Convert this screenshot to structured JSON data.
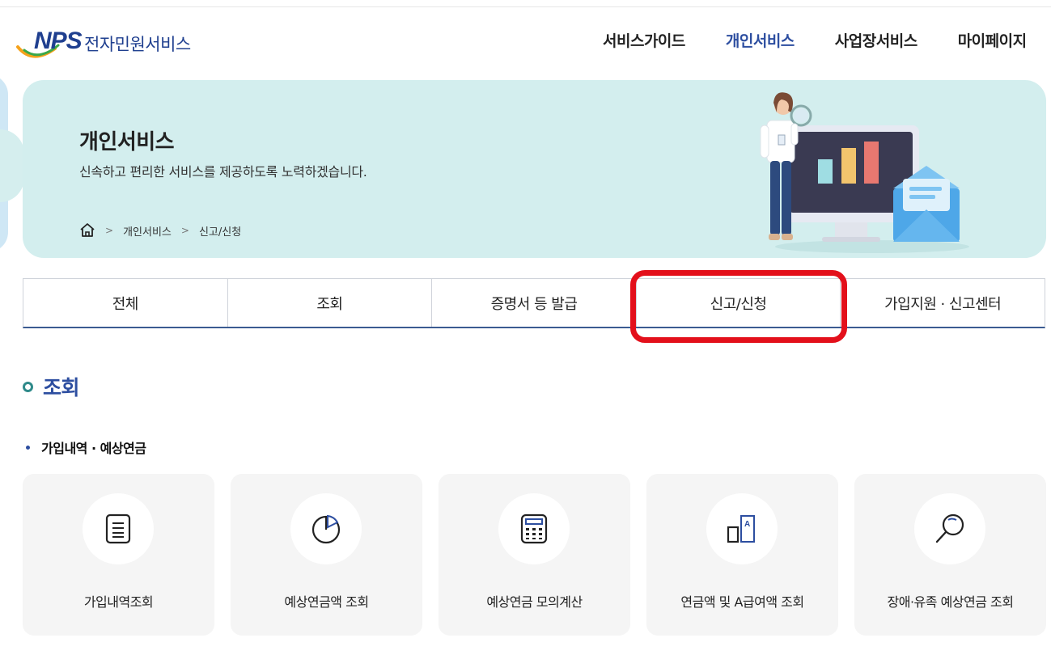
{
  "header": {
    "logo_mark": "NPS",
    "logo_text": "전자민원서비스",
    "nav": [
      {
        "label": "서비스가이드",
        "active": false
      },
      {
        "label": "개인서비스",
        "active": true
      },
      {
        "label": "사업장서비스",
        "active": false
      },
      {
        "label": "마이페이지",
        "active": false
      }
    ]
  },
  "banner": {
    "title": "개인서비스",
    "subtitle": "신속하고 편리한 서비스를 제공하도록 노력하겠습니다.",
    "breadcrumb": [
      "개인서비스",
      "신고/신청"
    ]
  },
  "tabs": [
    {
      "label": "전체"
    },
    {
      "label": "조회"
    },
    {
      "label": "증명서 등 발급"
    },
    {
      "label": "신고/신청",
      "highlighted": true
    },
    {
      "label": "가입지원 · 신고센터"
    }
  ],
  "section": {
    "title": "조회",
    "subsection": "가입내역 · 예상연금",
    "cards": [
      {
        "label": "가입내역조회",
        "icon": "document-icon"
      },
      {
        "label": "예상연금액 조회",
        "icon": "pie-chart-icon"
      },
      {
        "label": "예상연금 모의계산",
        "icon": "calculator-icon"
      },
      {
        "label": "연금액 및 A급여액 조회",
        "icon": "bar-a-icon"
      },
      {
        "label": "장애·유족 예상연금 조회",
        "icon": "magnifier-icon"
      }
    ]
  },
  "colors": {
    "brand": "#2d4ea0",
    "banner_bg": "#d3eeee",
    "highlight": "#e3101b"
  }
}
